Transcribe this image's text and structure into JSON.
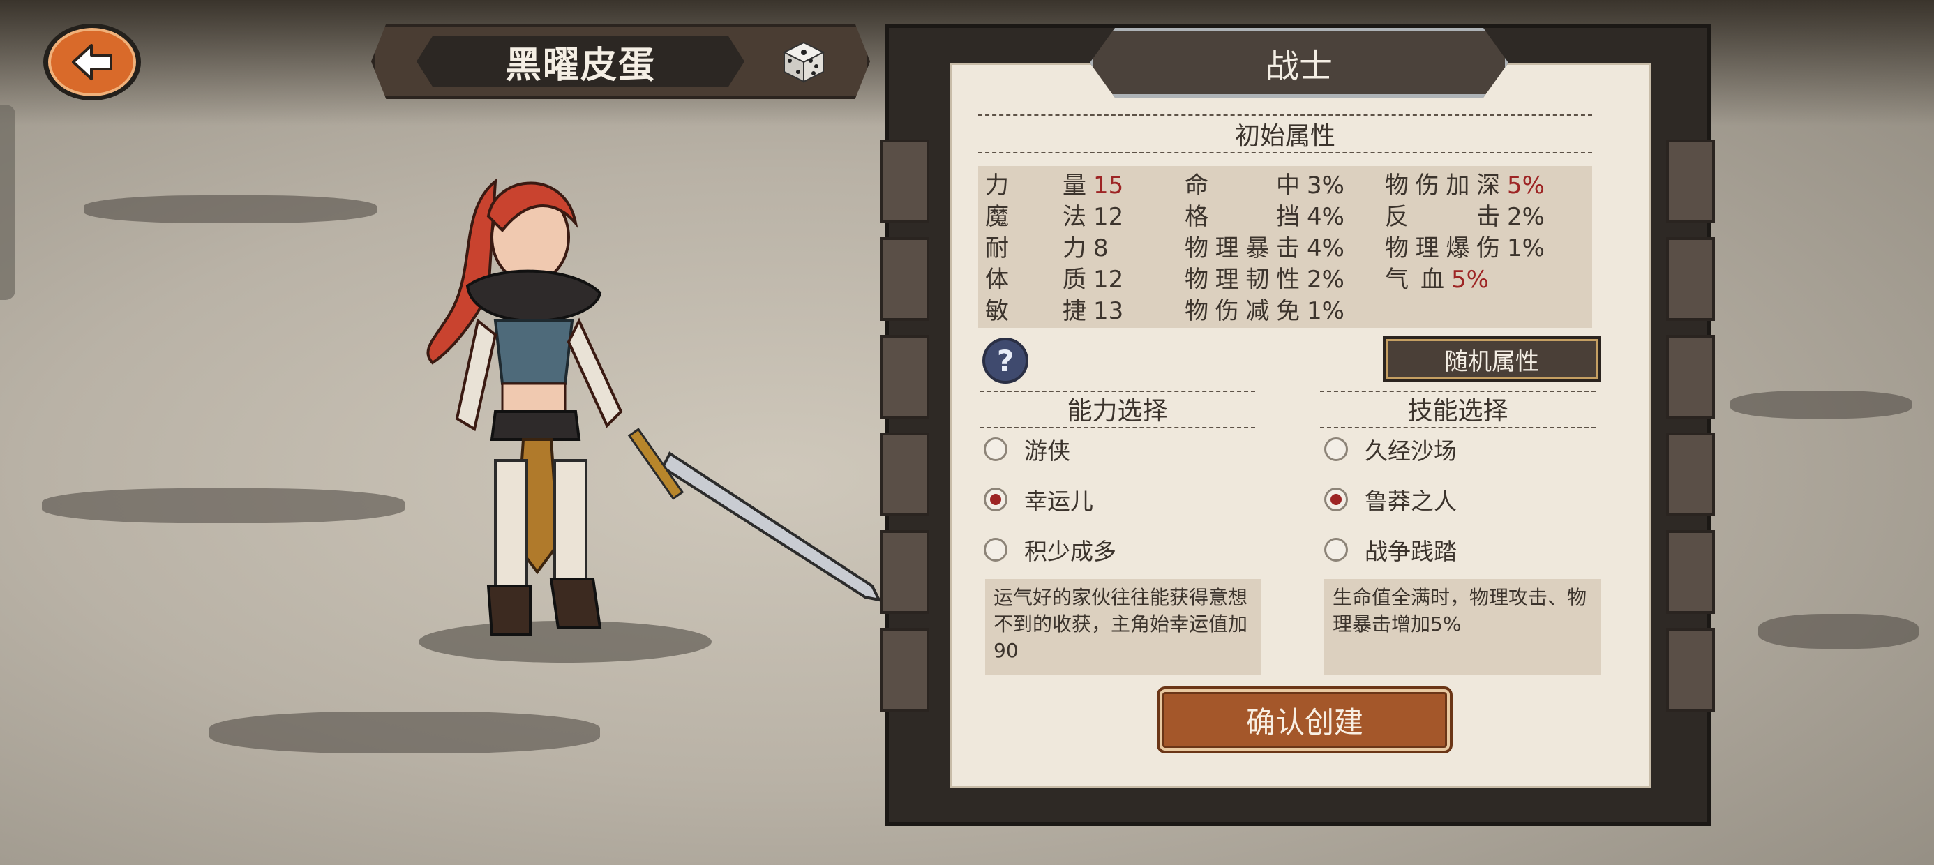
{
  "character": {
    "name": "黑曜皮蛋",
    "class": "战士"
  },
  "attributes": {
    "title": "初始属性",
    "col1": [
      {
        "label": "力量",
        "value": "15",
        "highlight": true
      },
      {
        "label": "魔法",
        "value": "12",
        "highlight": false
      },
      {
        "label": "耐力",
        "value": "8",
        "highlight": false
      },
      {
        "label": "体质",
        "value": "12",
        "highlight": false
      },
      {
        "label": "敏捷",
        "value": "13",
        "highlight": false
      }
    ],
    "col2": [
      {
        "label": "命中",
        "value": "3%",
        "highlight": false
      },
      {
        "label": "格挡",
        "value": "4%",
        "highlight": false
      },
      {
        "label": "物理暴击",
        "value": "4%",
        "highlight": false
      },
      {
        "label": "物理韧性",
        "value": "2%",
        "highlight": false
      },
      {
        "label": "物伤减免",
        "value": "1%",
        "highlight": false
      }
    ],
    "col3": [
      {
        "label": "物伤加深",
        "value": "5%",
        "highlight": true
      },
      {
        "label": "反击",
        "value": "2%",
        "highlight": false
      },
      {
        "label": "物理爆伤",
        "value": "1%",
        "highlight": false
      },
      {
        "label": "气血",
        "value": "5%",
        "highlight": true
      }
    ]
  },
  "buttons": {
    "help": "?",
    "randomize": "随机属性",
    "confirm": "确认创建"
  },
  "ability": {
    "title": "能力选择",
    "options": [
      "游侠",
      "幸运儿",
      "积少成多"
    ],
    "selected_index": 1,
    "description": "运气好的家伙往往能获得意想不到的收获，主角始幸运值加90"
  },
  "skill": {
    "title": "技能选择",
    "options": [
      "久经沙场",
      "鲁莽之人",
      "战争践踏"
    ],
    "selected_index": 1,
    "description": "生命值全满时，物理攻击、物理暴击增加5%"
  },
  "colors": {
    "accent_red": "#9d2424",
    "button_orange": "#a4572a",
    "back_orange": "#d96a2a",
    "paper": "#efe8dc"
  },
  "icons": {
    "back": "back-arrow-icon",
    "dice": "dice-icon",
    "help": "question-icon"
  }
}
